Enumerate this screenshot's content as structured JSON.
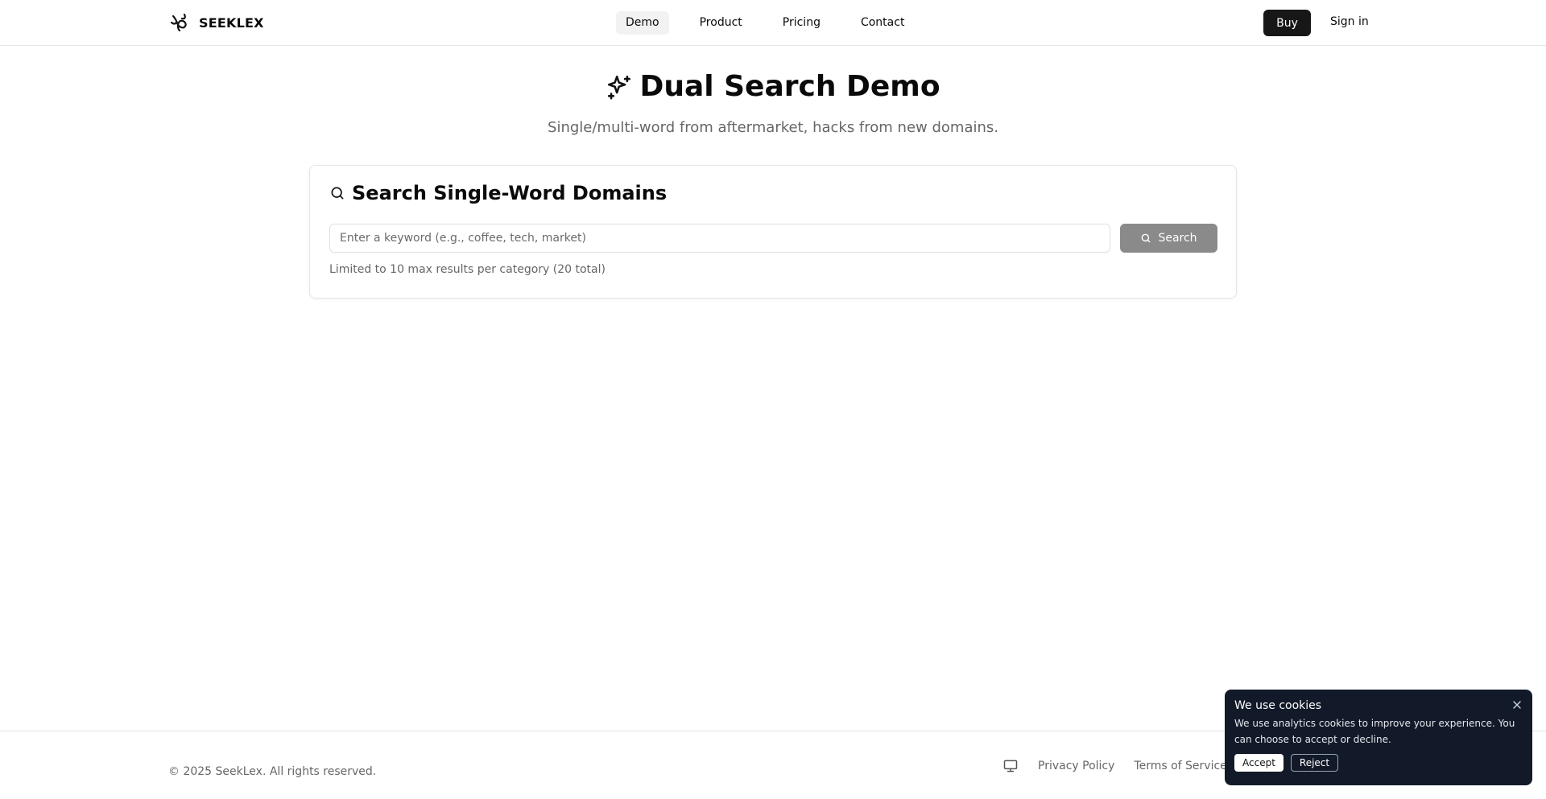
{
  "header": {
    "brand": "SEEKLEX",
    "nav": [
      {
        "label": "Demo",
        "active": true
      },
      {
        "label": "Product",
        "active": false
      },
      {
        "label": "Pricing",
        "active": false
      },
      {
        "label": "Contact",
        "active": false
      }
    ],
    "buy_label": "Buy",
    "signin_label": "Sign in"
  },
  "hero": {
    "title": "Dual Search Demo",
    "subtitle": "Single/multi-word from aftermarket, hacks from new domains."
  },
  "search_card": {
    "title": "Search Single-Word Domains",
    "placeholder": "Enter a keyword (e.g., coffee, tech, market)",
    "value": "",
    "button_label": "Search",
    "note": "Limited to 10 max results per category (20 total)"
  },
  "footer": {
    "copyright": "© 2025 SeekLex. All rights reserved.",
    "links": [
      "Privacy Policy",
      "Terms of Service"
    ]
  },
  "cookie": {
    "title": "We use cookies",
    "text": "We use analytics cookies to improve your experience. You can choose to accept or decline.",
    "accept_label": "Accept",
    "reject_label": "Reject"
  },
  "colors": {
    "primary": "#171717",
    "search_button": "#8a8a8a",
    "cookie_bg": "#121a2a",
    "muted_text": "#666666"
  }
}
